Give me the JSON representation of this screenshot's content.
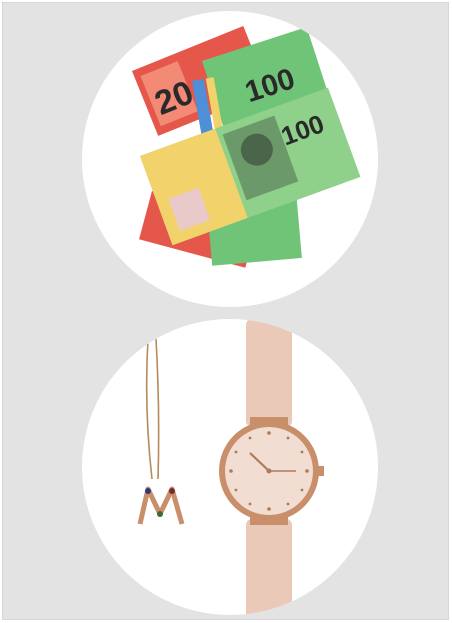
{
  "banknotes": {
    "twenty_denomination": "20",
    "hundred_denomination": "100",
    "colors": {
      "red_note": "#e4574a",
      "green_note": "#6fc478",
      "blue_note": "#4f8fd6",
      "yellow_note": "#f2d36b",
      "green_dark": "#3f9a55"
    }
  },
  "jewelry": {
    "colors": {
      "rose_gold": "#c98f6a",
      "strap": "#ebc9b8",
      "dial": "#f1ddd1",
      "chain": "#b88a5a"
    }
  }
}
